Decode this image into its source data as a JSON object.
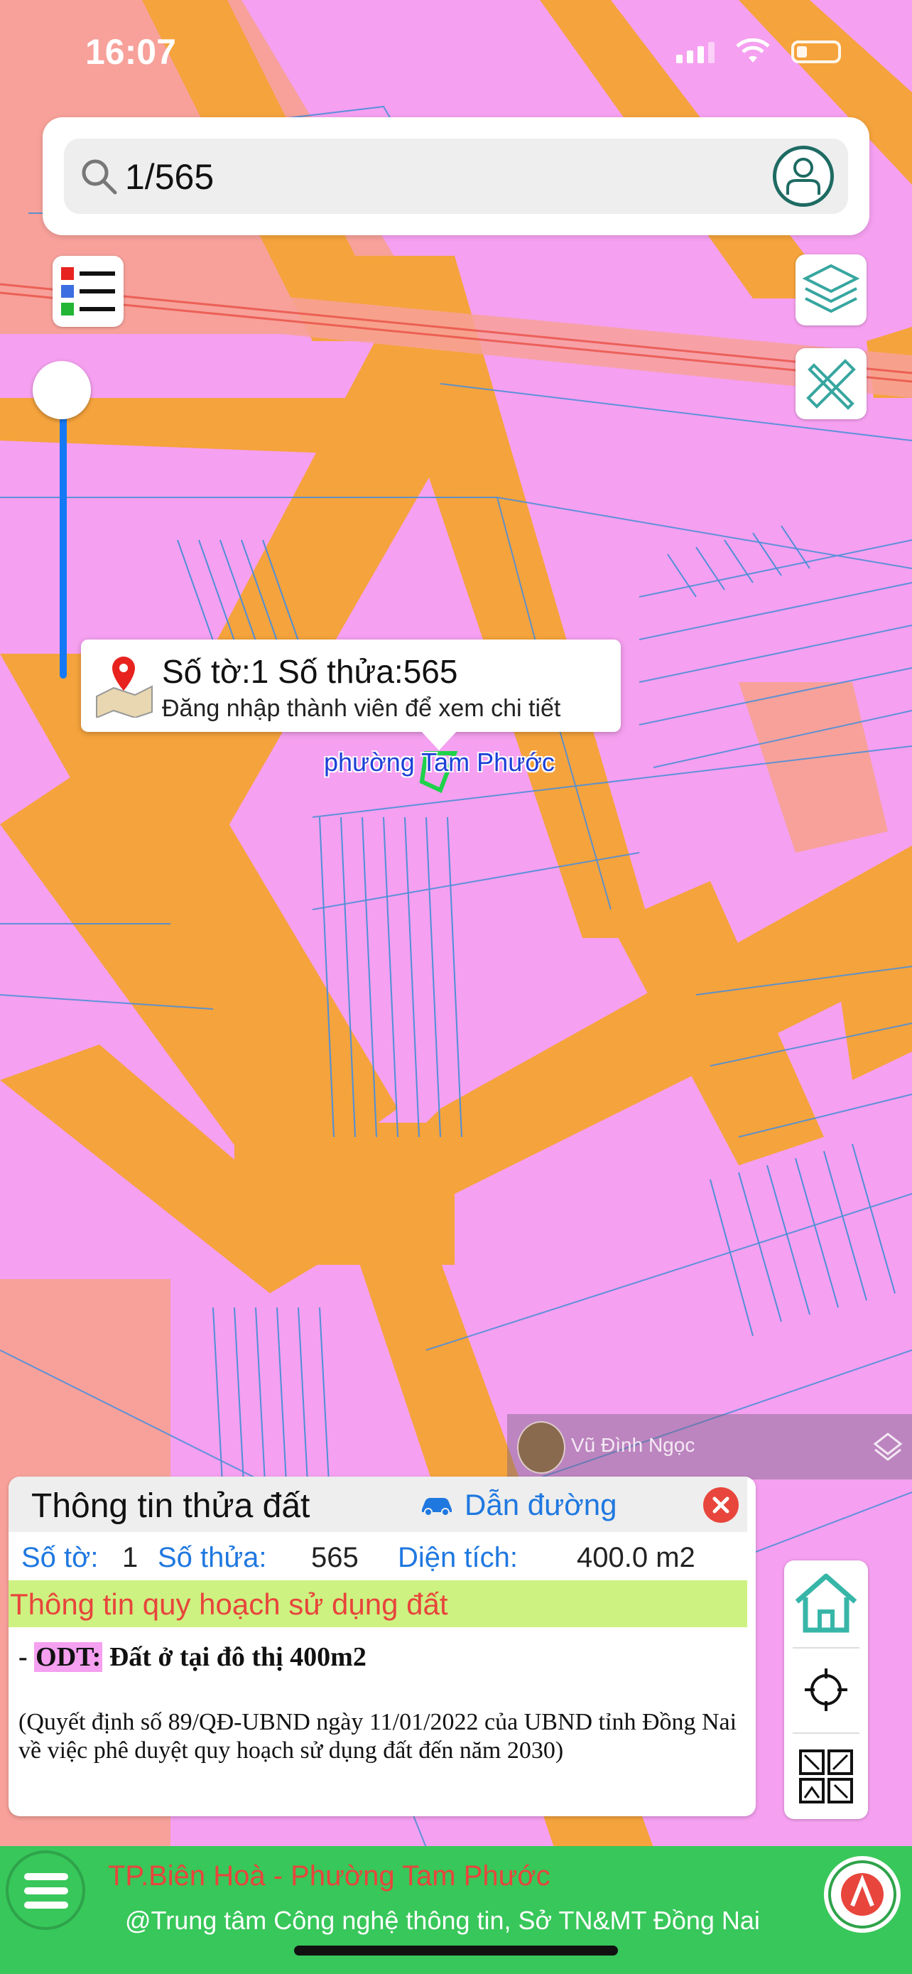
{
  "status_bar": {
    "time": "16:07"
  },
  "search": {
    "value": "1/565"
  },
  "popup": {
    "title": "Số tờ:1 Số thửa:565",
    "subtitle": "Đăng nhập thành viên để xem chi tiết"
  },
  "map_label": {
    "ward": "phường Tam Phước"
  },
  "credit": {
    "name": "Vũ Đình Ngọc"
  },
  "panel": {
    "title": "Thông tin thửa đất",
    "route_label": "Dẫn đường",
    "sheet_label": "Số tờ:",
    "sheet_value": "1",
    "parcel_label": "Số thửa:",
    "parcel_value": "565",
    "area_label": "Diện tích:",
    "area_value": "400.0 m2",
    "plan_header": "Thông tin quy hoạch sử dụng đất",
    "odt_prefix": "- ",
    "odt_code": "ODT:",
    "odt_desc": " Đất ở tại đô thị 400m2",
    "decision": "(Quyết định số 89/QĐ-UBND ngày 11/01/2022 của UBND tỉnh Đồng Nai về việc phê duyệt quy hoạch sử dụng đất đến năm 2030)"
  },
  "footer": {
    "city": "TP.Biên Hoà - Phường Tam Phước",
    "org": "@Trung tâm Công nghệ thông tin, Sở TN&MT Đồng Nai"
  },
  "colors": {
    "residential_land": "#f5a0f0",
    "road": "#f5a33c",
    "other_land": "#f7a19a",
    "parcel_lines": "#4f8fd8",
    "accent_blue": "#1f78e0",
    "accent_red": "#e8453c",
    "footer_green": "#38c75a",
    "plan_header_bg": "#cdf281"
  },
  "icons": {
    "search": "magnifier-icon",
    "avatar": "user-icon",
    "legend": "legend-list-icon",
    "layers": "layers-icon",
    "measure": "ruler-pencil-icon",
    "pin": "map-pin-icon",
    "car": "car-icon",
    "close": "close-icon",
    "home": "home-icon",
    "locate": "crosshair-icon",
    "qr": "qr-scan-icon",
    "menu": "hamburger-icon"
  }
}
